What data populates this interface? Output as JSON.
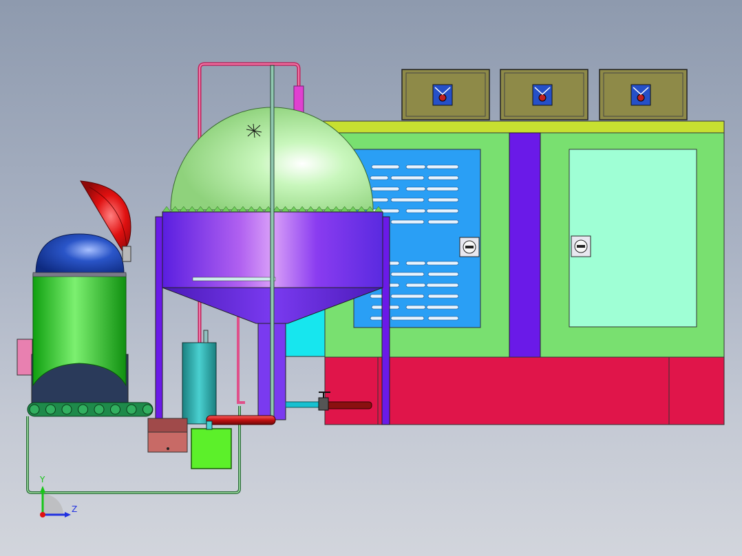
{
  "view": {
    "background_top": "#8e9aae",
    "background_bottom": "#d2d5dc"
  },
  "triad": {
    "y_label": "Y",
    "z_label": "Z",
    "y_color": "#17c417",
    "z_color": "#2030e0",
    "x_color": "#e01010"
  },
  "palette": {
    "cabinet_green": "#79e070",
    "cabinet_base_red": "#e0154a",
    "top_strip": "#c7e031",
    "panel_blue": "#2a9ff5",
    "panel_mint": "#9fffd5",
    "divider_purple": "#6a1ae8",
    "motor_box": "#8e8a48",
    "motor_icon": "#2550c8",
    "tank_purple": "#6f3cf0",
    "dome_green": "#b8f0a8",
    "hopper_green": "#22d018",
    "hopper_dome": "#1a3fb0",
    "lid_red": "#e01010",
    "conveyor": "#1e8a4a",
    "cylinder_teal": "#2aa8a8",
    "pump_green": "#5cf02a",
    "pipe_red": "#c01818",
    "pipe_pink": "#e0508a",
    "cyan_block": "#17e6ee"
  }
}
